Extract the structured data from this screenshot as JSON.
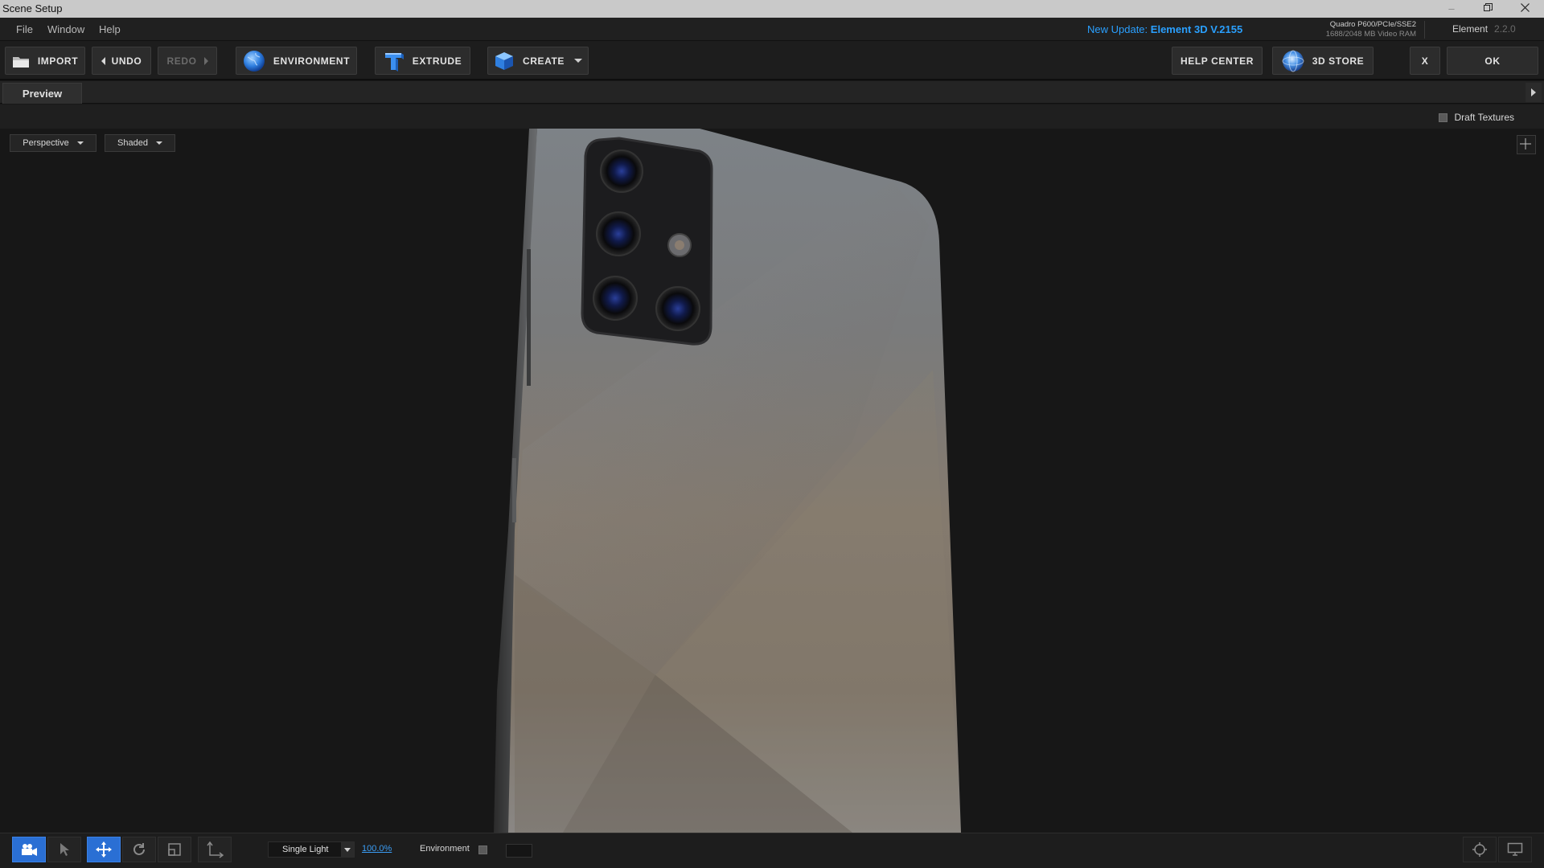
{
  "window": {
    "title": "Scene Setup"
  },
  "menu": {
    "items": [
      "File",
      "Window",
      "Help"
    ],
    "update_label": "New Update:",
    "update_version": "Element 3D V.2155",
    "gpu_name": "Quadro P600/PCIe/SSE2",
    "gpu_vram": "1688/2048 MB Video RAM",
    "product_name": "Element",
    "product_version": "2.2.0"
  },
  "toolbar": {
    "import": "IMPORT",
    "undo": "UNDO",
    "redo": "REDO",
    "environment": "ENVIRONMENT",
    "extrude": "EXTRUDE",
    "create": "CREATE",
    "help_center": "HELP CENTER",
    "store": "3D STORE",
    "close": "X",
    "ok": "OK"
  },
  "tabs": {
    "preview": "Preview"
  },
  "viewport": {
    "draft_textures": "Draft Textures",
    "draft_textures_checked": false,
    "camera_mode": "Perspective",
    "render_mode": "Shaded"
  },
  "bottom": {
    "tools": [
      "camera-tool",
      "select-tool",
      "move-tool",
      "rotate-tool",
      "scale-tool",
      "pivot-tool"
    ],
    "active_tool": "move-tool",
    "light_mode": "Single Light",
    "light_intensity": "100.0%",
    "environment_label": "Environment",
    "environment_checked": false
  },
  "colors": {
    "accent": "#2a6fd4",
    "link": "#2aa0ff",
    "background": "#171717"
  }
}
